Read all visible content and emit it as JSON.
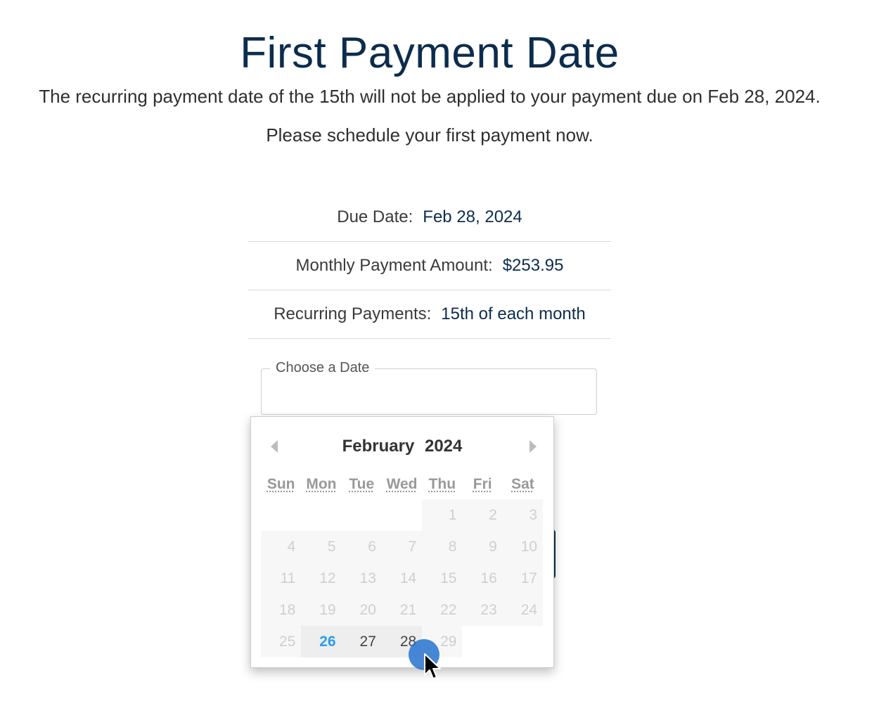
{
  "page": {
    "title": "First Payment Date",
    "subtitle_line1": "The recurring payment date of the 15th will not be applied to your payment due on Feb 28, 2024.",
    "subtitle_line2": "Please schedule your first payment now."
  },
  "summary": [
    {
      "label": "Due Date:",
      "value": "Feb 28, 2024"
    },
    {
      "label": "Monthly Payment Amount:",
      "value": "$253.95"
    },
    {
      "label": "Recurring Payments:",
      "value": "15th of each month"
    }
  ],
  "date_field": {
    "label": "Choose a Date",
    "value": ""
  },
  "calendar": {
    "month": "February",
    "year": "2024",
    "weekdays": [
      "Sun",
      "Mon",
      "Tue",
      "Wed",
      "Thu",
      "Fri",
      "Sat"
    ],
    "weeks": [
      [
        {
          "d": ""
        },
        {
          "d": ""
        },
        {
          "d": ""
        },
        {
          "d": ""
        },
        {
          "d": "1",
          "s": "disabled"
        },
        {
          "d": "2",
          "s": "disabled"
        },
        {
          "d": "3",
          "s": "disabled"
        }
      ],
      [
        {
          "d": "4",
          "s": "disabled"
        },
        {
          "d": "5",
          "s": "disabled"
        },
        {
          "d": "6",
          "s": "disabled"
        },
        {
          "d": "7",
          "s": "disabled"
        },
        {
          "d": "8",
          "s": "disabled"
        },
        {
          "d": "9",
          "s": "disabled"
        },
        {
          "d": "10",
          "s": "disabled"
        }
      ],
      [
        {
          "d": "11",
          "s": "disabled"
        },
        {
          "d": "12",
          "s": "disabled"
        },
        {
          "d": "13",
          "s": "disabled"
        },
        {
          "d": "14",
          "s": "disabled"
        },
        {
          "d": "15",
          "s": "disabled"
        },
        {
          "d": "16",
          "s": "disabled"
        },
        {
          "d": "17",
          "s": "disabled"
        }
      ],
      [
        {
          "d": "18",
          "s": "disabled"
        },
        {
          "d": "19",
          "s": "disabled"
        },
        {
          "d": "20",
          "s": "disabled"
        },
        {
          "d": "21",
          "s": "disabled"
        },
        {
          "d": "22",
          "s": "disabled"
        },
        {
          "d": "23",
          "s": "disabled"
        },
        {
          "d": "24",
          "s": "disabled"
        }
      ],
      [
        {
          "d": "25",
          "s": "disabled"
        },
        {
          "d": "26",
          "s": "today"
        },
        {
          "d": "27",
          "s": "enabled"
        },
        {
          "d": "28",
          "s": "enabled"
        },
        {
          "d": "29",
          "s": "disabled"
        },
        {
          "d": ""
        },
        {
          "d": ""
        }
      ]
    ],
    "prev_icon": "chevron-left-icon",
    "next_icon": "chevron-right-icon"
  },
  "colors": {
    "title": "#0d2c4d",
    "value_text": "#0d2c4d",
    "today_text": "#2b9cf2",
    "disabled_text": "#cfcfcf",
    "cursor_dot": "#2f76cf"
  }
}
